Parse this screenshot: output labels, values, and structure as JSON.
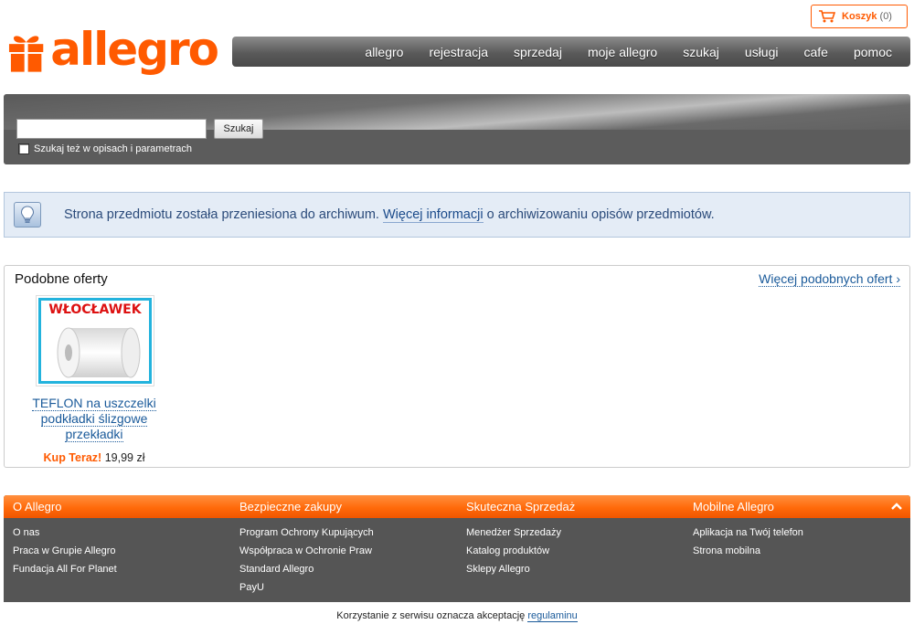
{
  "logo": {
    "text": "allegro",
    "icon": "gift-icon",
    "color": "#ff5a00"
  },
  "cart": {
    "label": "Koszyk",
    "count": "(0)",
    "icon": "cart-icon"
  },
  "nav": {
    "items": [
      {
        "label": "allegro"
      },
      {
        "label": "rejestracja"
      },
      {
        "label": "sprzedaj"
      },
      {
        "label": "moje allegro"
      },
      {
        "label": "szukaj"
      },
      {
        "label": "usługi"
      },
      {
        "label": "cafe"
      },
      {
        "label": "pomoc"
      }
    ]
  },
  "search": {
    "value": "",
    "button_label": "Szukaj",
    "option_label": "Szukaj też w opisach i parametrach"
  },
  "info": {
    "icon": "lightbulb-icon",
    "text_before": "Strona przedmiotu została przeniesiona do archiwum. ",
    "link": "Więcej informacji",
    "text_after": " o archiwizowaniu opisów przedmiotów."
  },
  "similar": {
    "title": "Podobne oferty",
    "more_link": "Więcej podobnych ofert ›",
    "offers": [
      {
        "image_label": "WŁOCŁAWEK",
        "title": "TEFLON na uszczelki podkładki ślizgowe przekładki",
        "price_label": "Kup Teraz!",
        "price": "19,99 zł"
      }
    ]
  },
  "footer": {
    "columns": [
      {
        "title": "O Allegro",
        "links": [
          "O nas",
          "Praca w Grupie Allegro",
          "Fundacja All For Planet"
        ]
      },
      {
        "title": "Bezpieczne zakupy",
        "links": [
          "Program Ochrony Kupujących",
          "Współpraca w Ochronie Praw",
          "Standard Allegro",
          "PayU"
        ]
      },
      {
        "title": "Skuteczna Sprzedaż",
        "links": [
          "Menedżer Sprzedaży",
          "Katalog produktów",
          "Sklepy Allegro"
        ]
      },
      {
        "title": "Mobilne Allegro",
        "links": [
          "Aplikacja na Twój telefon",
          "Strona mobilna"
        ]
      }
    ],
    "collapse_icon": "chevron-up-icon"
  },
  "legal": {
    "text": "Korzystanie z serwisu oznacza akceptację ",
    "link": "regulaminu"
  }
}
